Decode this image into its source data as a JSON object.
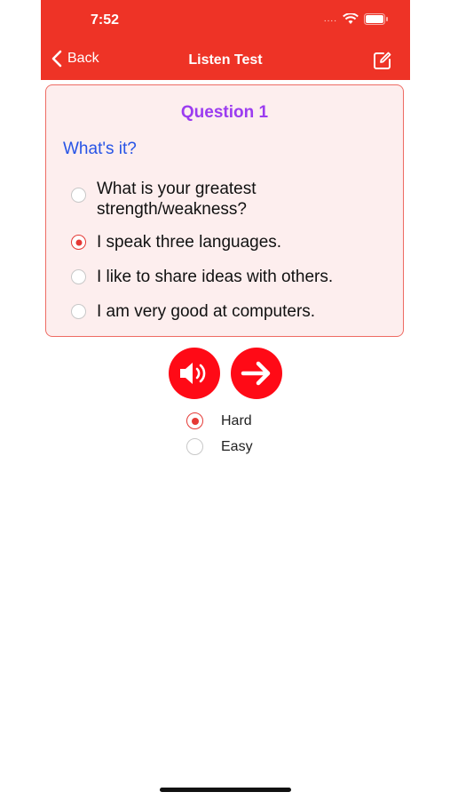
{
  "status_bar": {
    "time": "7:52",
    "signal_dots": "...."
  },
  "nav": {
    "back_label": "Back",
    "title": "Listen Test"
  },
  "question": {
    "title": "Question 1",
    "prompt": "What's it?",
    "options": [
      {
        "label": "What is your greatest strength/weakness?",
        "selected": false
      },
      {
        "label": "I speak three languages.",
        "selected": true
      },
      {
        "label": "I like to share ideas with others.",
        "selected": false
      },
      {
        "label": "I am very good at computers.",
        "selected": false
      }
    ]
  },
  "controls": {
    "speaker_icon": "speaker-icon",
    "next_icon": "arrow-right-icon"
  },
  "difficulty": [
    {
      "label": "Hard",
      "selected": true
    },
    {
      "label": "Easy",
      "selected": false
    }
  ],
  "colors": {
    "header": "#ee3326",
    "accent": "#ff0a16",
    "question_title": "#9b3cf0",
    "prompt": "#2754e6",
    "card_bg": "#fdeeee"
  }
}
